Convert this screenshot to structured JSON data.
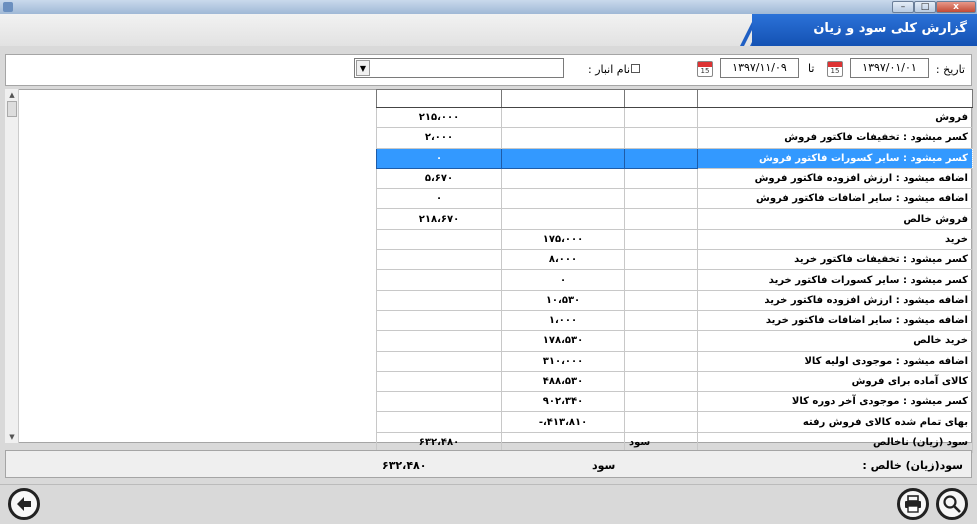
{
  "window": {
    "title_icon": "app-icon",
    "minimize": "–",
    "maximize": "□",
    "close": "x"
  },
  "header": {
    "title": "گزارش کلی سود و زیان"
  },
  "filters": {
    "date_label": "تاریخ :",
    "date_from": "۱۳۹۷/۰۱/۰۱",
    "to_label": "تا",
    "date_to": "۱۳۹۷/۱۱/۰۹",
    "calendar_day": "15",
    "warehouse_label": "نام انبار :",
    "warehouse_checked": false,
    "warehouse_value": ""
  },
  "table": {
    "rows": [
      {
        "name": "فروش",
        "col2": "",
        "col3": "",
        "col4": "۲۱۵،۰۰۰"
      },
      {
        "name": "کسر میشود : تخفیفات فاکتور فروش",
        "col2": "",
        "col3": "",
        "col4": "۲،۰۰۰"
      },
      {
        "name": "کسر میشود : سایر کسورات فاکتور فروش",
        "col2": "",
        "col3": "",
        "col4": "۰",
        "selected": true
      },
      {
        "name": "اضافه میشود : ارزش افزوده فاکتور فروش",
        "col2": "",
        "col3": "",
        "col4": "۵،۶۷۰"
      },
      {
        "name": "اضافه میشود : سایر اضافات فاکتور فروش",
        "col2": "",
        "col3": "",
        "col4": "۰"
      },
      {
        "name": "فروش خالص",
        "col2": "",
        "col3": "",
        "col4": "۲۱۸،۶۷۰"
      },
      {
        "name": "خرید",
        "col2": "",
        "col3": "۱۷۵،۰۰۰",
        "col4": ""
      },
      {
        "name": "کسر میشود : تخفیفات فاکتور خرید",
        "col2": "",
        "col3": "۸،۰۰۰",
        "col4": ""
      },
      {
        "name": "کسر میشود : سایر کسورات فاکتور خرید",
        "col2": "",
        "col3": "۰",
        "col4": ""
      },
      {
        "name": "اضافه میشود : ارزش افزوده فاکتور خرید",
        "col2": "",
        "col3": "۱۰،۵۳۰",
        "col4": ""
      },
      {
        "name": "اضافه میشود : سایر اضافات فاکتور خرید",
        "col2": "",
        "col3": "۱،۰۰۰",
        "col4": ""
      },
      {
        "name": "خرید خالص",
        "col2": "",
        "col3": "۱۷۸،۵۳۰",
        "col4": ""
      },
      {
        "name": "اضافه میشود : موجودی اولیه کالا",
        "col2": "",
        "col3": "۳۱۰،۰۰۰",
        "col4": ""
      },
      {
        "name": "کالای آماده برای فروش",
        "col2": "",
        "col3": "۴۸۸،۵۳۰",
        "col4": ""
      },
      {
        "name": "کسر میشود : موجودی آخر دوره کالا",
        "col2": "",
        "col3": "۹۰۲،۳۴۰",
        "col4": ""
      },
      {
        "name": "بهای تمام شده کالای فروش رفته",
        "col2": "",
        "col3": "۴۱۳،۸۱۰،-",
        "col4": ""
      },
      {
        "name": "سود (زیان) ناخالص",
        "col2": "سود",
        "col3": "",
        "col4": "۶۳۲،۴۸۰"
      }
    ]
  },
  "footer": {
    "label": "سود(زیان) خالص :",
    "status": "سود",
    "value": "۶۳۲،۴۸۰"
  }
}
